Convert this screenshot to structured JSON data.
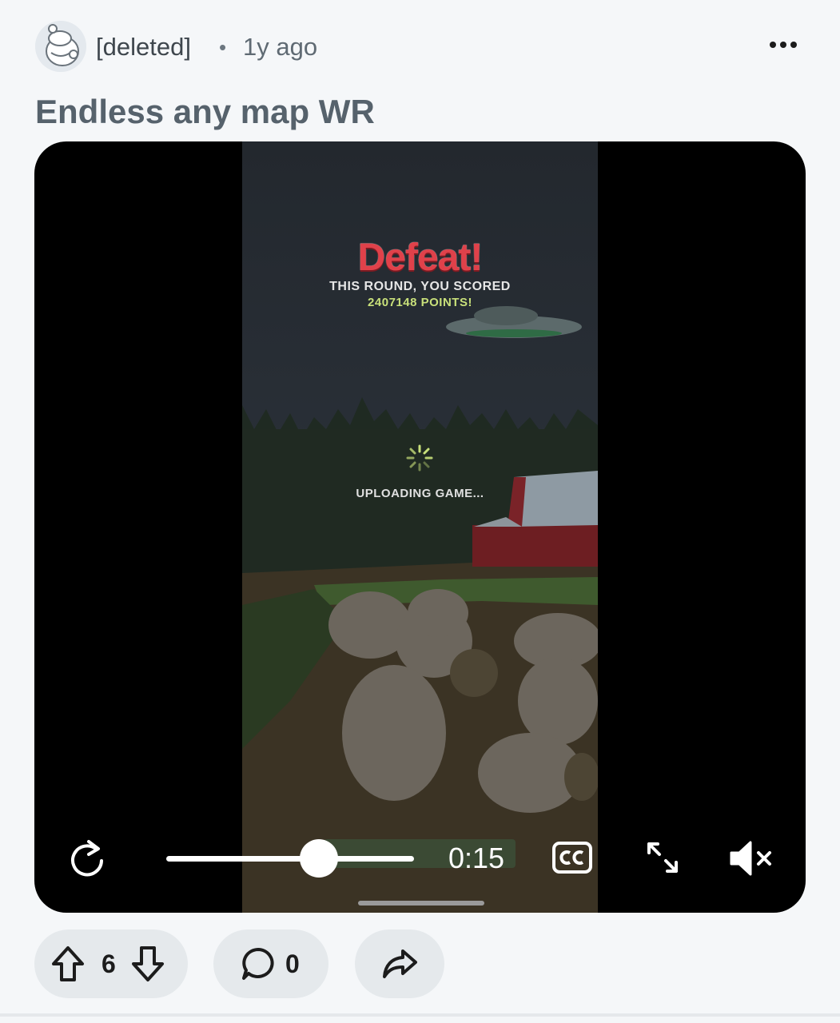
{
  "post": {
    "username": "[deleted]",
    "separator": "•",
    "time": "1y ago",
    "title": "Endless any map WR"
  },
  "video": {
    "game_text": {
      "headline": "Defeat!",
      "round_line": "THIS ROUND, YOU SCORED",
      "points_line": "2407148 POINTS!",
      "status": "UPLOADING GAME..."
    },
    "timecode": "0:15",
    "progress": 0.53,
    "icons": [
      "replay-icon",
      "closed-captions-icon",
      "expand-icon",
      "mute-icon"
    ]
  },
  "actions": {
    "upvotes": "6",
    "comments": "0"
  },
  "colors": {
    "background": "#f5f7f9",
    "pill": "#e5e9ec",
    "title": "#56626c",
    "defeat_red": "#e0414a",
    "points_green": "#c8e07a"
  }
}
